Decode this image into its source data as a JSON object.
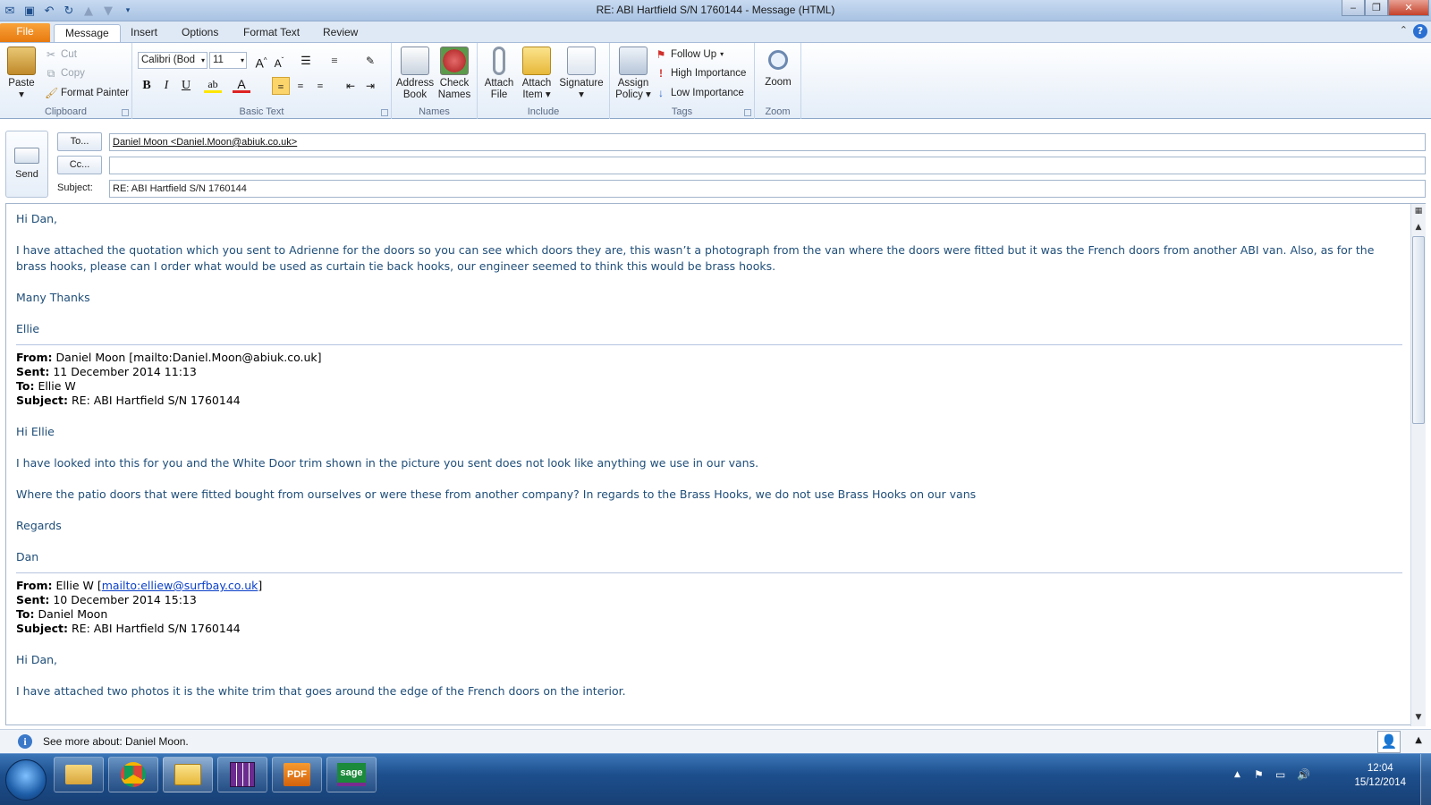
{
  "window": {
    "title": "RE: ABI Hartfield S/N 1760144  -  Message (HTML)"
  },
  "tabs": [
    "File",
    "Message",
    "Insert",
    "Options",
    "Format Text",
    "Review"
  ],
  "ribbon": {
    "clipboard": {
      "paste": "Paste",
      "cut": "Cut",
      "copy": "Copy",
      "format_painter": "Format Painter",
      "label": "Clipboard"
    },
    "basic_text": {
      "font": "Calibri (Bod",
      "size": "11",
      "bold": "B",
      "italic": "I",
      "underline": "U",
      "label": "Basic Text"
    },
    "names": {
      "address_book_1": "Address",
      "address_book_2": "Book",
      "check_names_1": "Check",
      "check_names_2": "Names",
      "label": "Names"
    },
    "include": {
      "attach_file_1": "Attach",
      "attach_file_2": "File",
      "attach_item_1": "Attach",
      "attach_item_2": "Item",
      "signature": "Signature",
      "label": "Include"
    },
    "tags": {
      "assign_policy_1": "Assign",
      "assign_policy_2": "Policy",
      "follow_up": "Follow Up",
      "high_importance": "High Importance",
      "low_importance": "Low Importance",
      "label": "Tags"
    },
    "zoom": {
      "zoom": "Zoom",
      "label": "Zoom"
    }
  },
  "compose": {
    "send": "Send",
    "to_button": "To...",
    "cc_button": "Cc...",
    "subject_label": "Subject:",
    "to_value": "Daniel Moon <Daniel.Moon@abiuk.co.uk>",
    "cc_value": "",
    "subject_value": "RE: ABI Hartfield S/N 1760144"
  },
  "body": {
    "greeting": "Hi Dan,",
    "para1": "I have attached the quotation which you sent to Adrienne for the doors so you can see which doors they are, this wasn’t a photograph from the van where the doors were fitted but it was the French doors from another ABI van. Also, as for the brass hooks, please can I order what would be used as curtain tie back hooks, our engineer seemed to think this would be brass hooks.",
    "thanks": "Many Thanks",
    "sign": "Ellie",
    "reply1": {
      "from_label": "From:",
      "from": "Daniel Moon [mailto:Daniel.Moon@abiuk.co.uk]",
      "sent_label": "Sent:",
      "sent": "11 December 2014 11:13",
      "to_label": "To:",
      "to": "Ellie W",
      "subject_label": "Subject:",
      "subject": "RE: ABI Hartfield S/N 1760144",
      "greeting": "Hi Ellie",
      "para1": "I have looked into this for you and the White Door trim shown in the picture you sent does not look like anything we use in our vans.",
      "para2": "Where the patio doors that were fitted bought from ourselves or were these from another company? In regards to the Brass Hooks, we do not use Brass Hooks on our vans",
      "regards": "Regards",
      "sign": "Dan"
    },
    "reply2": {
      "from_label": "From:",
      "from_name": "Ellie W [",
      "from_link": "mailto:elliew@surfbay.co.uk",
      "from_end": "]",
      "sent_label": "Sent:",
      "sent": "10 December 2014 15:13",
      "to_label": "To:",
      "to": "Daniel Moon",
      "subject_label": "Subject:",
      "subject": "RE: ABI Hartfield S/N 1760144",
      "greeting": "Hi Dan,",
      "para1": "I have attached two photos it is the white trim that goes around the edge of the French doors on the interior."
    }
  },
  "people_pane": {
    "text": "See more about: Daniel Moon."
  },
  "taskbar": {
    "items": [
      "explorer",
      "chrome",
      "outlook",
      "calc",
      "pdf",
      "sage"
    ],
    "pdf_label": "PDF",
    "sage_label": "sage",
    "time": "12:04",
    "date": "15/12/2014"
  }
}
